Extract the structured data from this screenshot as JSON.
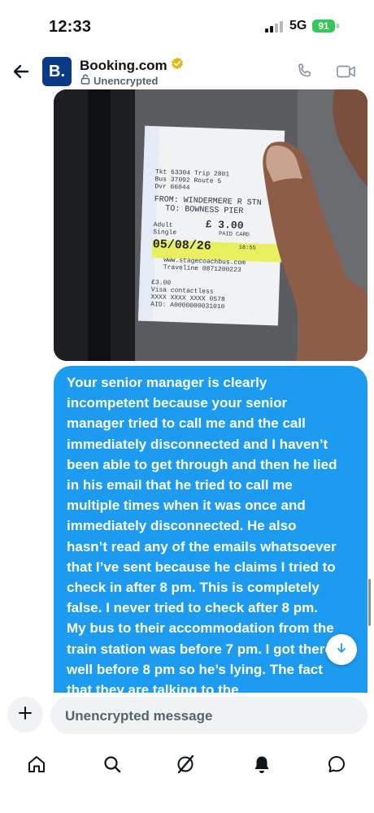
{
  "status_bar": {
    "time": "12:33",
    "network": "5G",
    "battery": "91"
  },
  "header": {
    "name": "Booking.com",
    "avatar_letter": "B.",
    "encryption": "Unencrypted"
  },
  "photo": {
    "ticket_lines": [
      "Tkt 63304   Trip 2801",
      "Bus 37092  Route 5",
      "Dvr 66044",
      "FROM: WINDERMERE R STN",
      "TO: BOWNESS PIER",
      "Adult",
      "£ 3.00",
      "PAID CARD",
      "Single",
      "05/08/26",
      "18:55",
      "www.stagecoachbus.com",
      "Traveline 0871200223",
      "£3.00",
      "Visa contactless",
      "XXXX XXXX XXXX 0578",
      "AID: A0000000031010"
    ]
  },
  "message": {
    "text": "Your senior manager is clearly\nincompetent because your senior\nmanager tried to call me and the call\nimmediately disconnected and I haven’t\nbeen able to get through and then he lied\nin his email that he tried to call me\nmultiple times when it was once and\nimmediately disconnected. He also\nhasn’t read any of the emails whatsoever\nthat I’ve sent because he claims I tried to\ncheck in after 8 pm. This is completely\nfalse. I never tried to check after 8 pm.\nMy bus to their accommodation from the\ntrain station was before 7 pm. I got there\nwell before 8 pm so he’s lying. The fact\nthat they are talking to the"
  },
  "composer": {
    "placeholder": "Unencrypted message"
  },
  "colors": {
    "accent": "#1d9bf0",
    "verified": "#e2b719",
    "battery": "#34c759"
  }
}
